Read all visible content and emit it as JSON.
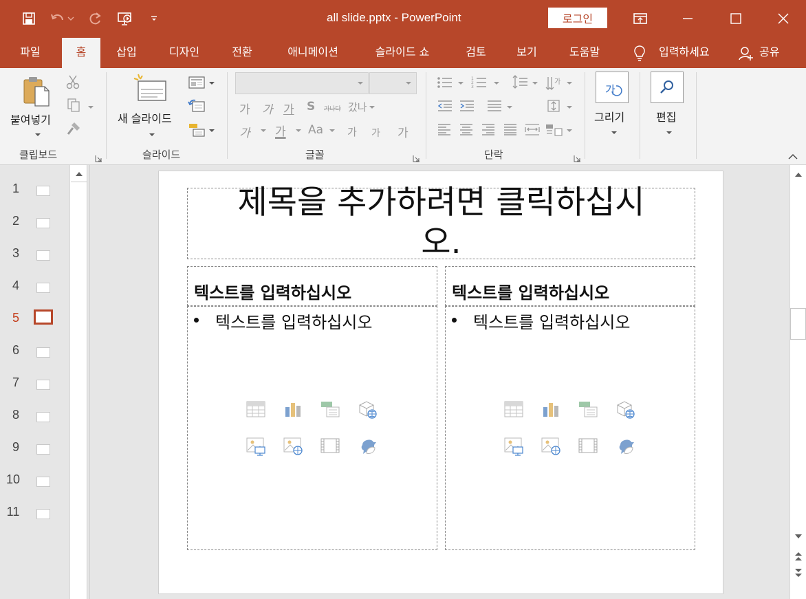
{
  "window": {
    "title": "all slide.pptx  -  PowerPoint",
    "login_label": "로그인"
  },
  "tabs": [
    {
      "label": "파일"
    },
    {
      "label": "홈"
    },
    {
      "label": "삽입"
    },
    {
      "label": "디자인"
    },
    {
      "label": "전환"
    },
    {
      "label": "애니메이션"
    },
    {
      "label": "슬라이드 쇼"
    },
    {
      "label": "검토"
    },
    {
      "label": "보기"
    },
    {
      "label": "도움말"
    },
    {
      "label": "입력하세요"
    },
    {
      "label": "공유"
    }
  ],
  "ribbon": {
    "paste_label": "붙여넣기",
    "new_slide_label": "새 슬라이드",
    "draw_label": "그리기",
    "edit_label": "편집",
    "groups": {
      "clipboard": "클립보드",
      "slides": "슬라이드",
      "font": "글꼴",
      "paragraph": "단락"
    },
    "font_buttons": {
      "bold": "가",
      "italic": "가",
      "underline": "가",
      "shadow": "S",
      "strike": "가나다",
      "spacing": "갔나",
      "highlight": "가",
      "color": "가",
      "size_change": "Aa",
      "grow": "가",
      "shrink": "가",
      "clear": "가"
    },
    "draw_icon_text": "가"
  },
  "thumbnails": {
    "items": [
      {
        "num": "1"
      },
      {
        "num": "2"
      },
      {
        "num": "3"
      },
      {
        "num": "4"
      },
      {
        "num": "5"
      },
      {
        "num": "6"
      },
      {
        "num": "7"
      },
      {
        "num": "8"
      },
      {
        "num": "9"
      },
      {
        "num": "10"
      },
      {
        "num": "11"
      }
    ],
    "active_index": 4
  },
  "slide": {
    "title_line1": "제목을 추가하려면 클릭하십시",
    "title_line2": "오.",
    "left": {
      "heading": "텍스트를 입력하십시오",
      "bullet": "텍스트를 입력하십시오"
    },
    "right": {
      "heading": "텍스트를 입력하십시오",
      "bullet": "텍스트를 입력하십시오"
    }
  },
  "colors": {
    "accent": "#b7472a",
    "ribbon_bg": "#f3f3f3"
  }
}
